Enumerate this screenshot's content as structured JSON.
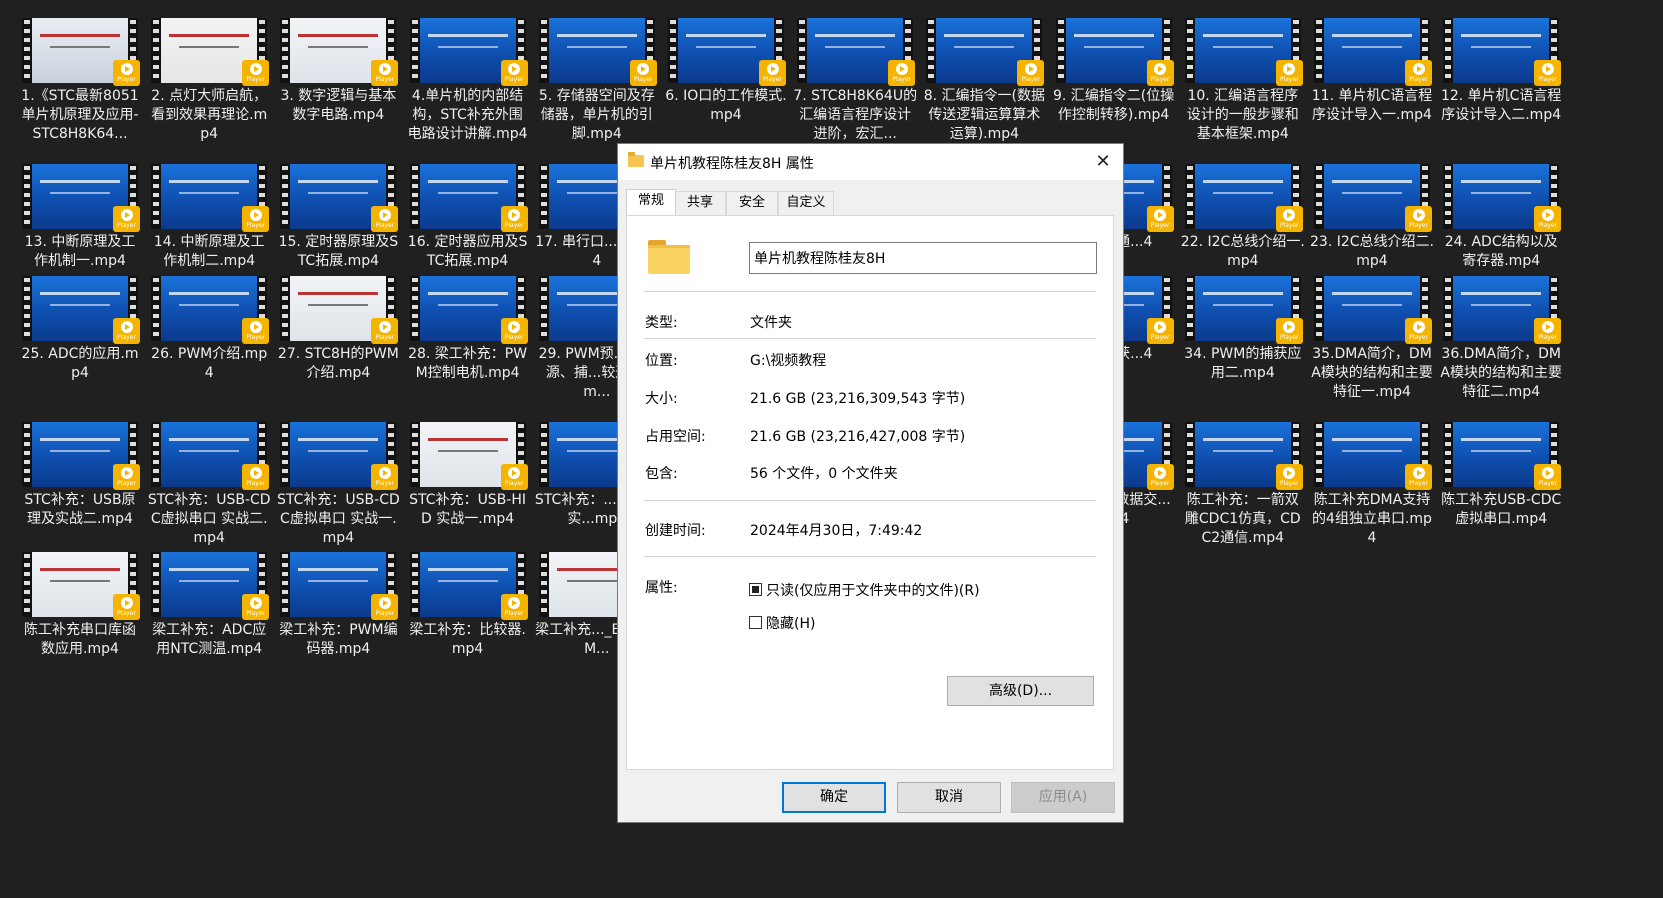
{
  "files": [
    {
      "name": "1.《STC最新8051单片机原理及应用-STC8H8K64...",
      "thumb": "photo"
    },
    {
      "name": "2. 点灯大师启航，看到效果再理论.mp4",
      "thumb": "white"
    },
    {
      "name": "3. 数字逻辑与基本数字电路.mp4",
      "thumb": "doc"
    },
    {
      "name": "4.单片机的内部结构，STC补充外围电路设计讲解.mp4",
      "thumb": "blue"
    },
    {
      "name": "5. 存储器空间及存储器，单片机的引脚.mp4",
      "thumb": "blue"
    },
    {
      "name": "6. IO口的工作模式.mp4",
      "thumb": "blue"
    },
    {
      "name": "7. STC8H8K64U的汇编语言程序设计进阶，宏汇...",
      "thumb": "blue"
    },
    {
      "name": "8. 汇编指令一(数据传送逻辑运算算术运算).mp4",
      "thumb": "blue"
    },
    {
      "name": "9. 汇编指令二(位操作控制转移).mp4",
      "thumb": "blue"
    },
    {
      "name": "10. 汇编语言程序设计的一般步骤和基本框架.mp4",
      "thumb": "blue"
    },
    {
      "name": "11. 单片机C语言程序设计导入一.mp4",
      "thumb": "blue"
    },
    {
      "name": "12. 单片机C语言程序设计导入二.mp4",
      "thumb": "blue"
    },
    {
      "name": "13. 中断原理及工作机制一.mp4",
      "thumb": "blue"
    },
    {
      "name": "14. 中断原理及工作机制二.mp4",
      "thumb": "blue"
    },
    {
      "name": "15. 定时器原理及STC拓展.mp4",
      "thumb": "blue"
    },
    {
      "name": "16. 定时器应用及STC拓展.mp4",
      "thumb": "blue"
    },
    {
      "name": "17. 串行口...一.mp4",
      "thumb": "blue"
    },
    {
      "name": "...口的通...4",
      "thumb": "blue"
    },
    {
      "name": "22. I2C总线介绍一.mp4",
      "thumb": "blue"
    },
    {
      "name": "23. I2C总线介绍二.mp4",
      "thumb": "blue"
    },
    {
      "name": "24. ADC结构以及寄存器.mp4",
      "thumb": "blue"
    },
    {
      "name": "25. ADC的应用.mp4",
      "thumb": "blue"
    },
    {
      "name": "26. PWM介绍.mp4",
      "thumb": "blue"
    },
    {
      "name": "27. STC8H的PWM介绍.mp4",
      "thumb": "doc"
    },
    {
      "name": "28. 梁工补充：PWM控制电机.mp4",
      "thumb": "blue"
    },
    {
      "name": "29. PWM预...时钟源、捕...较通道.m...",
      "thumb": "blue"
    },
    {
      "name": "...的捕获...4",
      "thumb": "blue"
    },
    {
      "name": "34. PWM的捕获应用二.mp4",
      "thumb": "blue"
    },
    {
      "name": "35.DMA简介，DMA模块的结构和主要特征一.mp4",
      "thumb": "blue"
    },
    {
      "name": "36.DMA简介，DMA模块的结构和主要特征二.mp4",
      "thumb": "blue"
    },
    {
      "name": "STC补充：USB原理及实战二.mp4",
      "thumb": "blue"
    },
    {
      "name": "STC补充：USB-CDC虚拟串口 实战二.mp4",
      "thumb": "blue"
    },
    {
      "name": "STC补充：USB-CDC虚拟串口 实战一.mp4",
      "thumb": "blue"
    },
    {
      "name": "STC补充：USB-HID 实战一.mp4",
      "thumb": "doc"
    },
    {
      "name": "STC补充：...原理及实...mp4",
      "thumb": "blue"
    },
    {
      "name": "...DMA...数据交...mp4",
      "thumb": "blue"
    },
    {
      "name": "陈工补充：一箭双雕CDC1仿真，CDC2通信.mp4",
      "thumb": "blue"
    },
    {
      "name": "陈工补充DMA支持的4组独立串口.mp4",
      "thumb": "blue"
    },
    {
      "name": "陈工补充USB-CDC虚拟串口.mp4",
      "thumb": "blue"
    },
    {
      "name": "陈工补充串口库函数应用.mp4",
      "thumb": "doc"
    },
    {
      "name": "梁工补充：ADC应用NTC测温.mp4",
      "thumb": "blue"
    },
    {
      "name": "梁工补充：PWM编码器.mp4",
      "thumb": "blue"
    },
    {
      "name": "梁工补充：比较器.mp4",
      "thumb": "blue"
    },
    {
      "name": "梁工补充..._EEPROM...",
      "thumb": "doc"
    }
  ],
  "dialog": {
    "title": "单片机教程陈桂友8H 属性",
    "close_glyph": "✕",
    "tabs": [
      "常规",
      "共享",
      "安全",
      "自定义"
    ],
    "folder_name": "单片机教程陈桂友8H",
    "rows": {
      "type_label": "类型:",
      "type_value": "文件夹",
      "location_label": "位置:",
      "location_value": "G:\\视频教程",
      "size_label": "大小:",
      "size_value": "21.6 GB (23,216,309,543 字节)",
      "disk_label": "占用空间:",
      "disk_value": "21.6 GB (23,216,427,008 字节)",
      "contains_label": "包含:",
      "contains_value": "56 个文件，0 个文件夹",
      "created_label": "创建时间:",
      "created_value": "2024年4月30日，7:49:42",
      "attrs_label": "属性:"
    },
    "readonly_label": "只读(仅应用于文件夹中的文件)(R)",
    "hidden_label": "隐藏(H)",
    "advanced_label": "高级(D)...",
    "ok_label": "确定",
    "cancel_label": "取消",
    "apply_label": "应用(A)"
  },
  "badge_text": "Player",
  "icons": {
    "folder": "folder-icon",
    "play": "play-icon"
  },
  "colors": {
    "background": "#202020",
    "badge": "#f4b400",
    "primary_border": "#0078d7"
  }
}
